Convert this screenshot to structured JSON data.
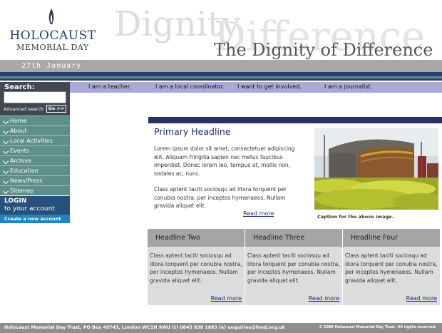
{
  "header": {
    "logo_line1": "HOLOCAUST",
    "logo_line2": "MEMORIAL DAY",
    "ghost_word1": "Dignity",
    "ghost_word2": "Difference",
    "tagline": "The Dignity of Difference",
    "date": "27th January"
  },
  "topnav": {
    "items": [
      "I am a teacher.",
      "I am a local coordinator.",
      "I want to get involved.",
      "I am a journalist."
    ]
  },
  "sidebar": {
    "search_label": "Search:",
    "search_value": "",
    "advanced_search": "Advanced search",
    "go_button": "Go >>",
    "menu": [
      "Home",
      "About",
      "Local Activities",
      "Events",
      "Archive",
      "Education",
      "News/Press",
      "Sitemap"
    ],
    "login_line1": "LOGIN",
    "login_line2": "to your account",
    "create_account": "Create a new account"
  },
  "main": {
    "primary_headline": "Primary Headline",
    "paragraph1": "Lorem ipsum dolor sit amet, consectetuer adipiscing elit. Aliquam fringilla sapien nec metus faucibus imperdiet. Donec lorem leo, tempus at, mollis non, sodales ac, nunc.",
    "paragraph2": "Class aptent taciti sociosqu ad litora torquent per conubia nostra, per inceptos hymenaeos. Nullam gravida aliquet elit.",
    "read_more": "Read more",
    "caption": "Caption for the above image."
  },
  "cards": [
    {
      "headline": "Headline Two",
      "body": "Class aptent taciti sociosqu ad litora torquent per conubia nostra, per inceptos hymenaeos. Nullam gravida aliquet elit.",
      "more": "Read more"
    },
    {
      "headline": "Headline Three",
      "body": "Class aptent taciti sociosqu ad litora torquent per conubia nostra, per inceptos hymenaeos. Nullam gravida aliquet elit.",
      "more": "Read more"
    },
    {
      "headline": "Headline Four",
      "body": "Class aptent taciti sociosqu ad litora torquent per conubia nostra, per inceptos hymenaeos. Nullam gravida aliquet elit.",
      "more": "Read more"
    }
  ],
  "footer": {
    "address": "Holocaust Memorial Day Trust, PO Box 49743, London WC1H 9WU  (t) 0845 838 1883 (e) enquiries@hmd.org.uk",
    "copyright": "© 2006 Holocaust Memorial Day Trust.  All rights reserved."
  }
}
